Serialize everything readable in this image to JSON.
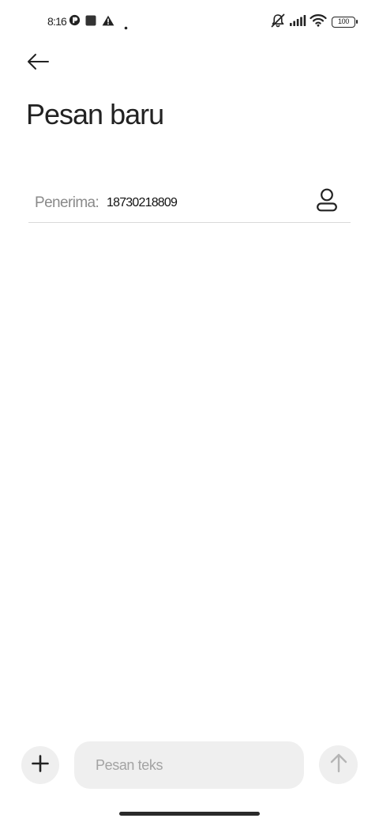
{
  "status_bar": {
    "time": "8:16",
    "battery_level": "100",
    "icons": [
      "record-indicator-icon",
      "square-notification-icon",
      "alert-triangle-icon",
      "dot-icon",
      "silent-mode-icon",
      "signal-bars-icon",
      "wifi-icon",
      "battery-icon"
    ]
  },
  "header": {
    "back_icon": "arrow-left-icon",
    "title": "Pesan baru"
  },
  "recipient": {
    "label": "Penerima:",
    "value": "18730218809",
    "contact_icon": "person-icon"
  },
  "composer": {
    "add_icon": "plus-icon",
    "placeholder": "Pesan teks",
    "value": "",
    "send_icon": "arrow-up-icon"
  },
  "colors": {
    "background": "#ffffff",
    "text_primary": "#222222",
    "text_secondary": "#8a8a8a",
    "input_background": "#efefef",
    "divider": "#d9d9d9",
    "send_disabled": "#b5b5b5"
  }
}
